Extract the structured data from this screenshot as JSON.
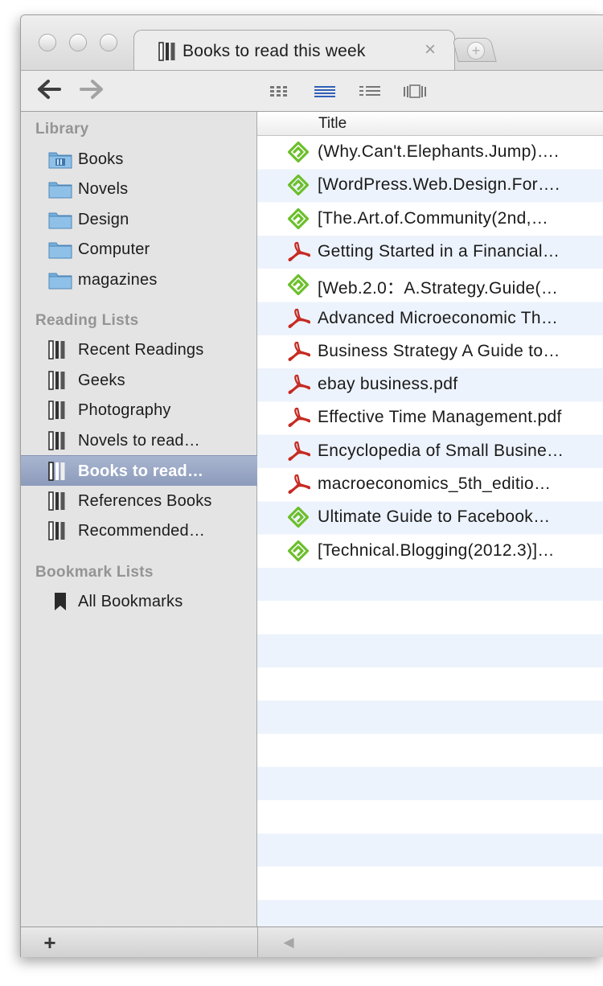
{
  "tab": {
    "title": "Books to read this week",
    "close_glyph": "×",
    "new_tab_glyph": "+"
  },
  "toolbar": {
    "back_glyph": "🡐",
    "forward_glyph": "🡒"
  },
  "sidebar": {
    "library_header": "Library",
    "library": [
      {
        "label": "Books",
        "icon": "book-folder-icon"
      },
      {
        "label": "Novels",
        "icon": "folder-icon"
      },
      {
        "label": "Design",
        "icon": "folder-icon"
      },
      {
        "label": "Computer",
        "icon": "folder-icon"
      },
      {
        "label": "magazines",
        "icon": "folder-icon"
      }
    ],
    "reading_header": "Reading Lists",
    "reading": [
      {
        "label": "Recent Readings"
      },
      {
        "label": "Geeks"
      },
      {
        "label": "Photography"
      },
      {
        "label": "Novels to read…"
      },
      {
        "label": "Books to read…",
        "selected": true
      },
      {
        "label": "References Books"
      },
      {
        "label": "Recommended…"
      }
    ],
    "bookmark_header": "Bookmark Lists",
    "bookmarks": [
      {
        "label": "All Bookmarks"
      }
    ]
  },
  "list": {
    "column_title": "Title",
    "rows": [
      {
        "title": "(Why.Can't.Elephants.Jump)….",
        "type": "epub"
      },
      {
        "title": "[WordPress.Web.Design.For….",
        "type": "epub"
      },
      {
        "title": "[The.Art.of.Community(2nd,…",
        "type": "epub"
      },
      {
        "title": "Getting Started in a Financial…",
        "type": "pdf"
      },
      {
        "title": "[Web.2.0：A.Strategy.Guide(…",
        "type": "epub"
      },
      {
        "title": "Advanced Microeconomic Th…",
        "type": "pdf"
      },
      {
        "title": "Business Strategy A Guide to…",
        "type": "pdf"
      },
      {
        "title": "ebay business.pdf",
        "type": "pdf"
      },
      {
        "title": "Effective Time Management.pdf",
        "type": "pdf"
      },
      {
        "title": "Encyclopedia of Small Busine…",
        "type": "pdf"
      },
      {
        "title": "macroeconomics_5th_editio…",
        "type": "pdf"
      },
      {
        "title": "Ultimate Guide to Facebook…",
        "type": "epub"
      },
      {
        "title": "[Technical.Blogging(2012.3)]…",
        "type": "epub"
      }
    ]
  },
  "bottom": {
    "add_glyph": "+",
    "scroll_left_glyph": "◀"
  },
  "colors": {
    "selection": "#8d9bbb",
    "epub_green": "#6cbf2b",
    "pdf_red": "#c62a22",
    "stripe": "#edf3fc"
  }
}
